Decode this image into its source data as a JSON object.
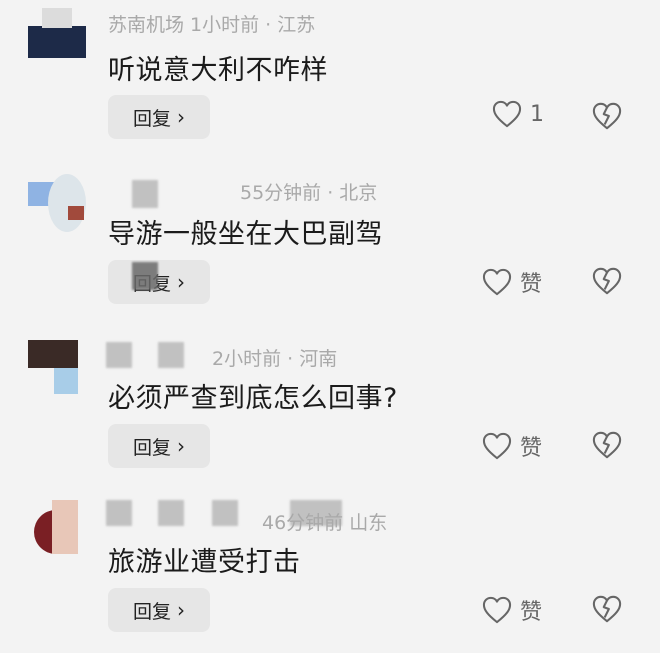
{
  "comments": [
    {
      "meta": "苏南机场  1小时前 · 江苏",
      "text": "听说意大利不咋样",
      "reply_label": "回复",
      "like_count": "1"
    },
    {
      "meta": "55分钟前 · 北京",
      "text": "导游一般坐在大巴副驾",
      "reply_label": "回复",
      "like_label": "赞"
    },
    {
      "meta": "2小时前 · 河南",
      "text": "必须严查到底怎么回事?",
      "reply_label": "回复",
      "like_label": "赞"
    },
    {
      "meta": "46分钟前   山东",
      "text": "旅游业遭受打击",
      "reply_label": "回复",
      "like_label": "赞"
    }
  ],
  "icons": {
    "like": "heart-outline-icon",
    "dislike": "broken-heart-icon",
    "reply_arrow": "chevron-right-icon"
  },
  "colors": {
    "background": "#f3f3f3",
    "reply_button": "#e6e6e6",
    "icon_stroke": "#666666",
    "meta_text": "#a9a9a9"
  }
}
